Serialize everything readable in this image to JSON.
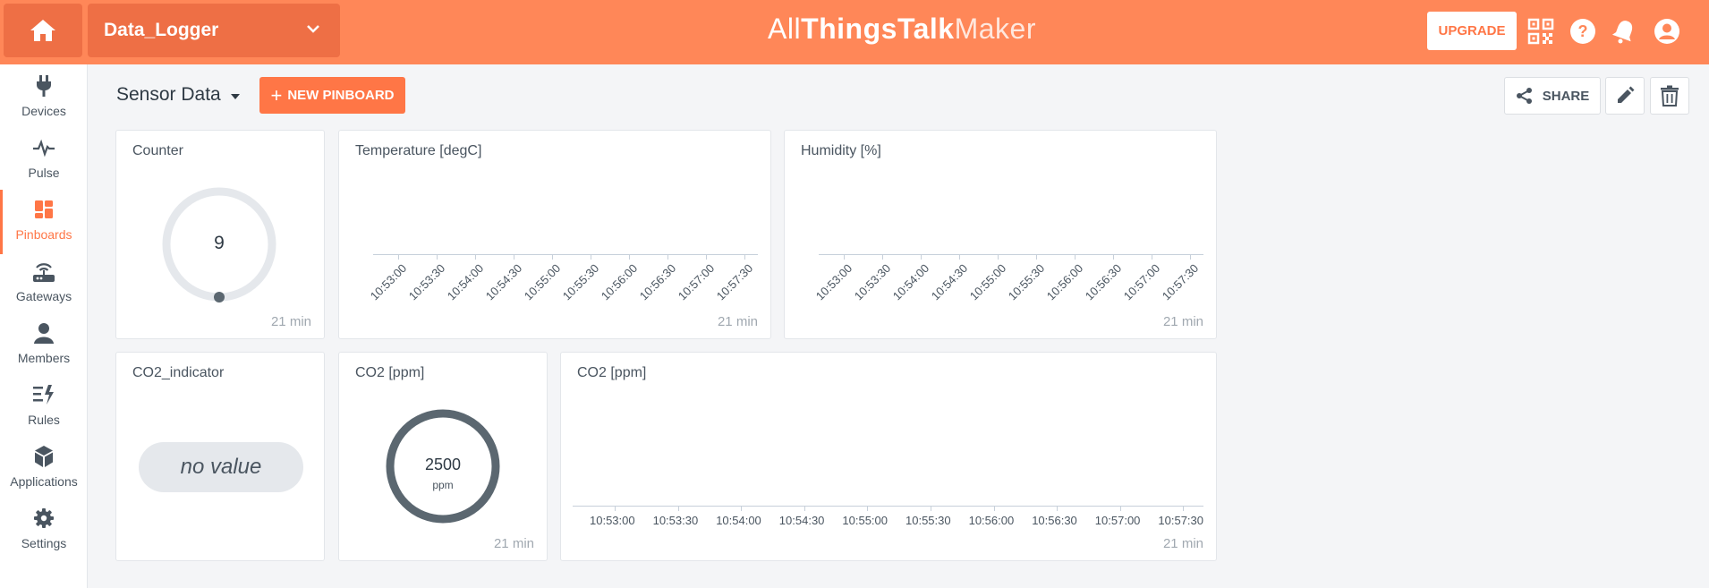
{
  "header": {
    "device": "Data_Logger",
    "brand": {
      "all": "All",
      "things": "Things",
      "talk": "Talk",
      "maker": "Maker"
    },
    "upgrade_label": "UPGRADE"
  },
  "sidebar": {
    "items": [
      {
        "label": "Devices",
        "icon": "plug-icon"
      },
      {
        "label": "Pulse",
        "icon": "pulse-icon"
      },
      {
        "label": "Pinboards",
        "icon": "pinboards-icon",
        "active": true
      },
      {
        "label": "Gateways",
        "icon": "gateway-icon"
      },
      {
        "label": "Members",
        "icon": "user-icon"
      },
      {
        "label": "Rules",
        "icon": "rules-icon"
      },
      {
        "label": "Applications",
        "icon": "cube-icon"
      },
      {
        "label": "Settings",
        "icon": "gear-icon"
      }
    ]
  },
  "toolbar": {
    "pinboard_name": "Sensor Data",
    "new_pinboard_label": "NEW PINBOARD",
    "share_label": "SHARE"
  },
  "cards": {
    "counter": {
      "title": "Counter",
      "value": "9",
      "age": "21 min"
    },
    "temperature": {
      "title": "Temperature [degC]",
      "age": "21 min"
    },
    "humidity": {
      "title": "Humidity [%]",
      "age": "21 min"
    },
    "co2_indicator": {
      "title": "CO2_indicator",
      "value": "no value"
    },
    "co2_gauge": {
      "title": "CO2 [ppm]",
      "value": "2500",
      "unit": "ppm",
      "age": "21 min"
    },
    "co2_chart": {
      "title": "CO2 [ppm]",
      "age": "21 min"
    }
  },
  "time_ticks": [
    "10:53:00",
    "10:53:30",
    "10:54:00",
    "10:54:30",
    "10:55:00",
    "10:55:30",
    "10:56:00",
    "10:56:30",
    "10:57:00",
    "10:57:30"
  ],
  "colors": {
    "brand": "#ff8758",
    "accent": "#ff7646",
    "gauge_dark": "#5b6770",
    "gauge_light": "#e5e8ec"
  }
}
